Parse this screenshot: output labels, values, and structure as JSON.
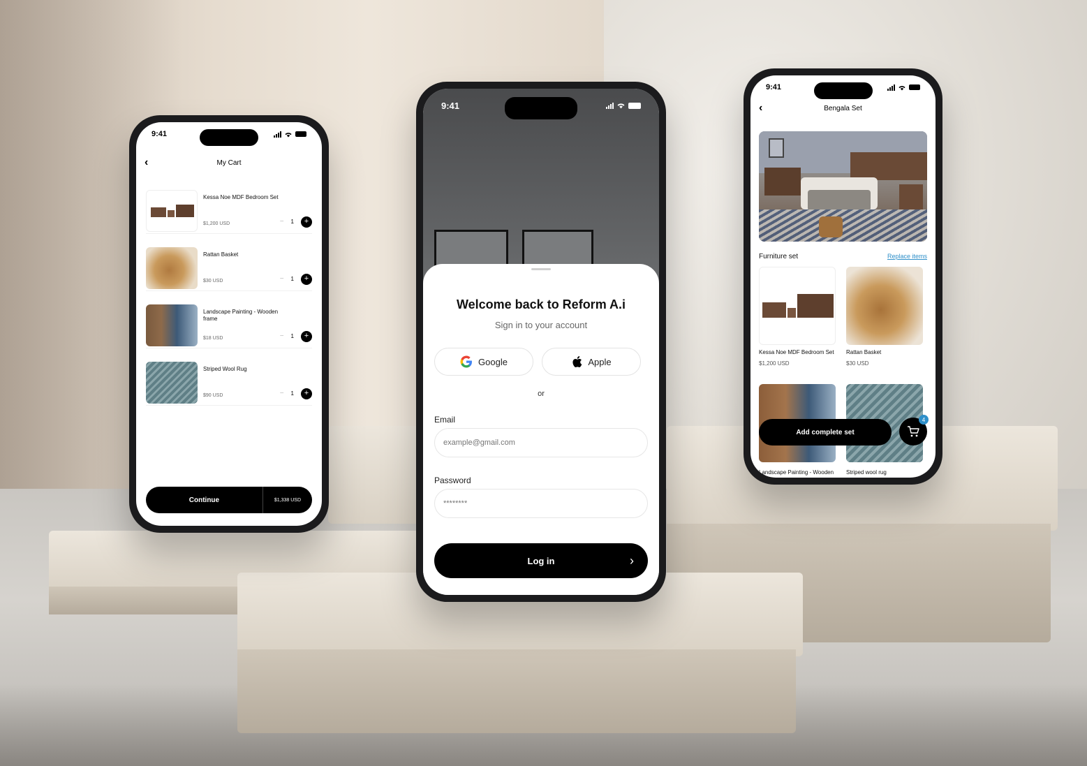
{
  "status_time": "9:41",
  "cart_screen": {
    "title": "My Cart",
    "items": [
      {
        "name": "Kessa Noe MDF Bedroom Set",
        "price": "$1,200 USD",
        "qty": "1"
      },
      {
        "name": "Rattan Basket",
        "price": "$30 USD",
        "qty": "1"
      },
      {
        "name": "Landscape Painting - Wooden frame",
        "price": "$18 USD",
        "qty": "1"
      },
      {
        "name": "Striped Wool Rug",
        "price": "$90 USD",
        "qty": "1"
      }
    ],
    "minus_glyph": "−",
    "plus_glyph": "+",
    "continue_label": "Continue",
    "total": "$1,338 USD"
  },
  "login_screen": {
    "title": "Welcome back to Reform A.i",
    "subtitle": "Sign in to your account",
    "google_label": "Google",
    "apple_label": "Apple",
    "or_label": "or",
    "email_label": "Email",
    "email_placeholder": "example@gmail.com",
    "password_label": "Password",
    "password_placeholder": "********",
    "login_label": "Log in"
  },
  "set_screen": {
    "title": "Bengala Set",
    "section_title": "Furniture set",
    "replace_label": "Replace items",
    "items": [
      {
        "name": "Kessa Noe MDF Bedroom Set",
        "price": "$1,200 USD"
      },
      {
        "name": "Rattan Basket",
        "price": "$30 USD"
      },
      {
        "name": "Landscape Painting - Wooden frame",
        "price": ""
      },
      {
        "name": "Striped wool rug",
        "price": ""
      }
    ],
    "add_label": "Add complete set",
    "cart_badge": "4"
  },
  "icons": {
    "back": "chevron-left-icon",
    "google": "google-logo-icon",
    "apple": "apple-logo-icon",
    "cart": "cart-icon"
  },
  "colors": {
    "accent": "#2e8fc9",
    "primary": "#000000"
  }
}
